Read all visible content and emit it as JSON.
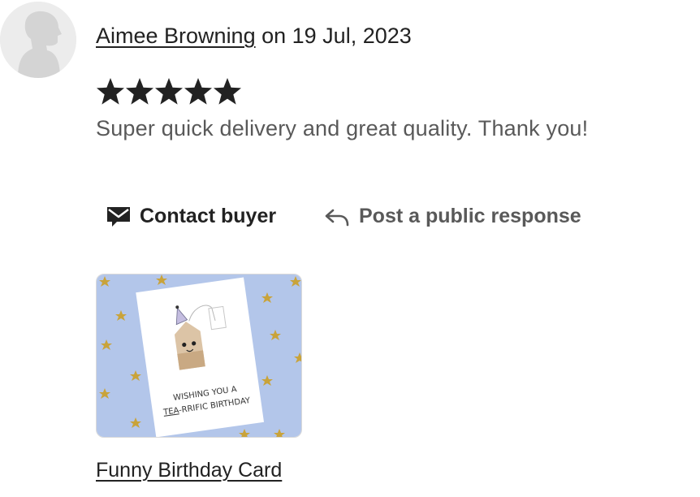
{
  "review": {
    "reviewer_name": "Aimee Browning",
    "date_prefix": " on ",
    "date": "19 Jul, 2023",
    "rating": 5,
    "rating_max": 5,
    "text": "Super quick delivery and great quality. Thank you!"
  },
  "actions": {
    "contact_label": "Contact buyer",
    "contact_icon": "envelope-icon",
    "respond_label": "Post a public response",
    "respond_icon": "reply-arrow-icon"
  },
  "product": {
    "title": "Funny Birthday Card",
    "card_text_line1": "WISHING YOU A",
    "card_text_line2_a": "TEA",
    "card_text_line2_b": "-RRIFIC BIRTHDAY"
  },
  "colors": {
    "text_primary": "#222222",
    "text_secondary": "#595959",
    "star": "#222222",
    "thumb_background": "#b3c6ea",
    "gold_star": "#c9a33a"
  }
}
